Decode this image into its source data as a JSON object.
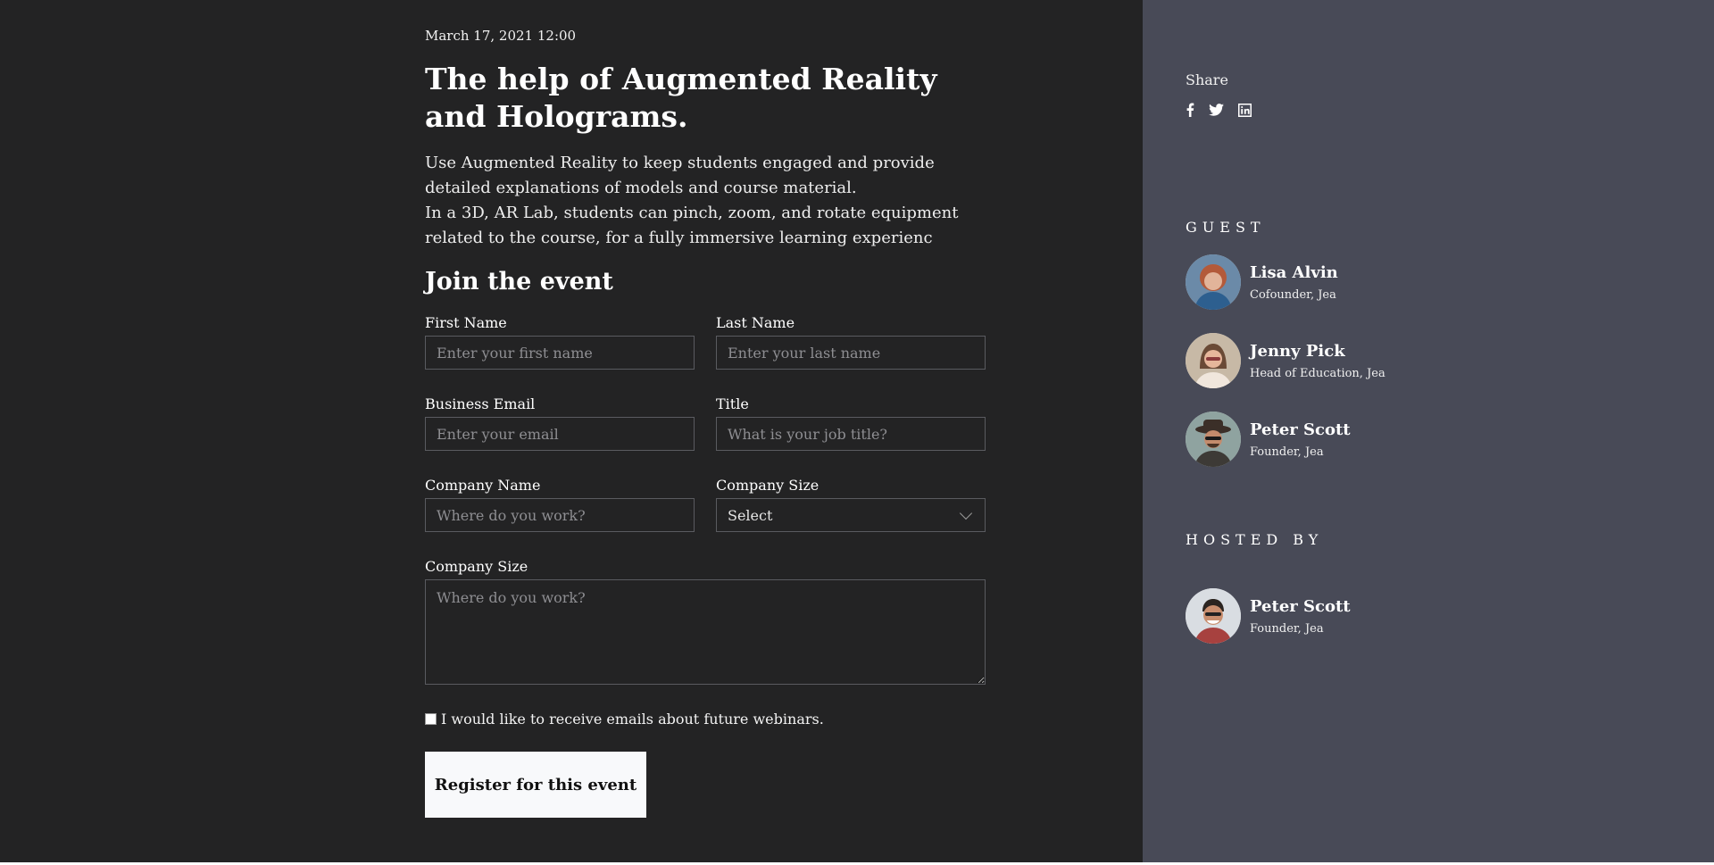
{
  "event": {
    "date": "March 17, 2021 12:00",
    "title": "The help of Augmented Reality and Holograms.",
    "description": "Use Augmented Reality to keep students engaged and provide detailed explanations of models and course material.\nIn a 3D, AR Lab, students can pinch, zoom, and rotate equipment related to the course, for a fully immersive learning experienc"
  },
  "form": {
    "heading": "Join the event",
    "first_name": {
      "label": "First Name",
      "placeholder": "Enter your first name"
    },
    "last_name": {
      "label": "Last Name",
      "placeholder": "Enter your last name"
    },
    "email": {
      "label": "Business Email",
      "placeholder": "Enter your email"
    },
    "job_title": {
      "label": "Title",
      "placeholder": "What is your job title?"
    },
    "company_name": {
      "label": "Company Name",
      "placeholder": "Where do you work?"
    },
    "company_size": {
      "label": "Company Size",
      "value": "Select"
    },
    "company_size_text": {
      "label": "Company Size",
      "placeholder": "Where do you work?"
    },
    "checkbox_label": "I would like to receive emails about future webinars.",
    "submit_label": "Register for this event"
  },
  "share": {
    "label": "Share",
    "icons": [
      "facebook-icon",
      "twitter-icon",
      "linkedin-icon"
    ]
  },
  "guests": {
    "title": "GUEST",
    "people": [
      {
        "name": "Lisa Alvin",
        "role": "Cofounder, Jea"
      },
      {
        "name": "Jenny Pick",
        "role": "Head of Education, Jea"
      },
      {
        "name": "Peter Scott",
        "role": "Founder, Jea"
      }
    ]
  },
  "hosts": {
    "title": "HOSTED BY",
    "people": [
      {
        "name": "Peter Scott",
        "role": "Founder, Jea"
      }
    ]
  },
  "colors": {
    "left_background": "#232324",
    "right_background": "#484a57",
    "button_background": "#f8f9fb"
  }
}
